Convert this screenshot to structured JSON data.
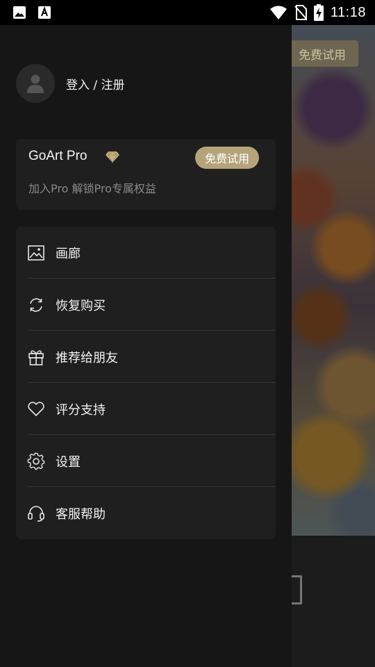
{
  "status_bar": {
    "time": "11:18",
    "icons": [
      "gallery-icon",
      "text-a-icon",
      "wifi-icon",
      "no-sim-icon",
      "battery-charging-icon"
    ]
  },
  "background": {
    "trial_label": "免费试用"
  },
  "drawer": {
    "login_label": "登入 / 注册",
    "pro": {
      "title": "GoArt Pro",
      "subtitle": "加入Pro 解锁Pro专属权益",
      "trial_button": "免费试用",
      "gem_icon": "diamond-icon",
      "accent_color": "#b5a47a"
    },
    "menu": [
      {
        "label": "画廊",
        "icon": "gallery-icon"
      },
      {
        "label": "恢复购买",
        "icon": "restore-icon"
      },
      {
        "label": "推荐给朋友",
        "icon": "gift-icon"
      },
      {
        "label": "评分支持",
        "icon": "heart-icon"
      },
      {
        "label": "设置",
        "icon": "gear-icon"
      },
      {
        "label": "客服帮助",
        "icon": "headset-icon"
      }
    ]
  }
}
